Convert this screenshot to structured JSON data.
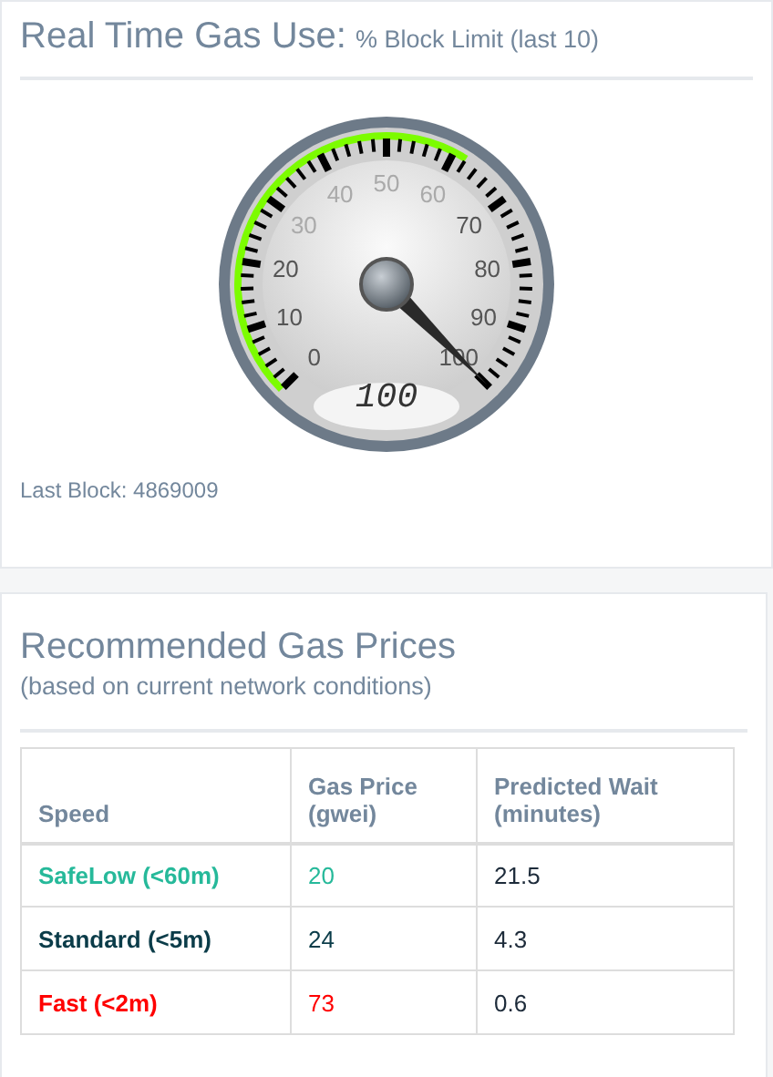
{
  "gas_use": {
    "title": "Real Time Gas Use:",
    "subtitle": "% Block Limit (last 10)",
    "gauge": {
      "scale_labels": [
        "0",
        "10",
        "20",
        "30",
        "40",
        "50",
        "60",
        "70",
        "80",
        "90",
        "100"
      ],
      "readout": "100"
    },
    "last_block": "Last Block: 4869009"
  },
  "prices": {
    "title": "Recommended Gas Prices",
    "subtitle": "(based on current network conditions)",
    "table": {
      "columns": [
        "Speed",
        "Gas Price (gwei)",
        "Predicted Wait (minutes)"
      ],
      "rows": [
        {
          "speed": "SafeLow (<60m)",
          "price": "20",
          "wait": "21.5",
          "color": "#26b99a"
        },
        {
          "speed": "Standard (<5m)",
          "price": "24",
          "wait": "4.3",
          "color": "#0b3c49"
        },
        {
          "speed": "Fast (<2m)",
          "price": "73",
          "wait": "0.6",
          "color": "#ff0000"
        }
      ]
    }
  }
}
